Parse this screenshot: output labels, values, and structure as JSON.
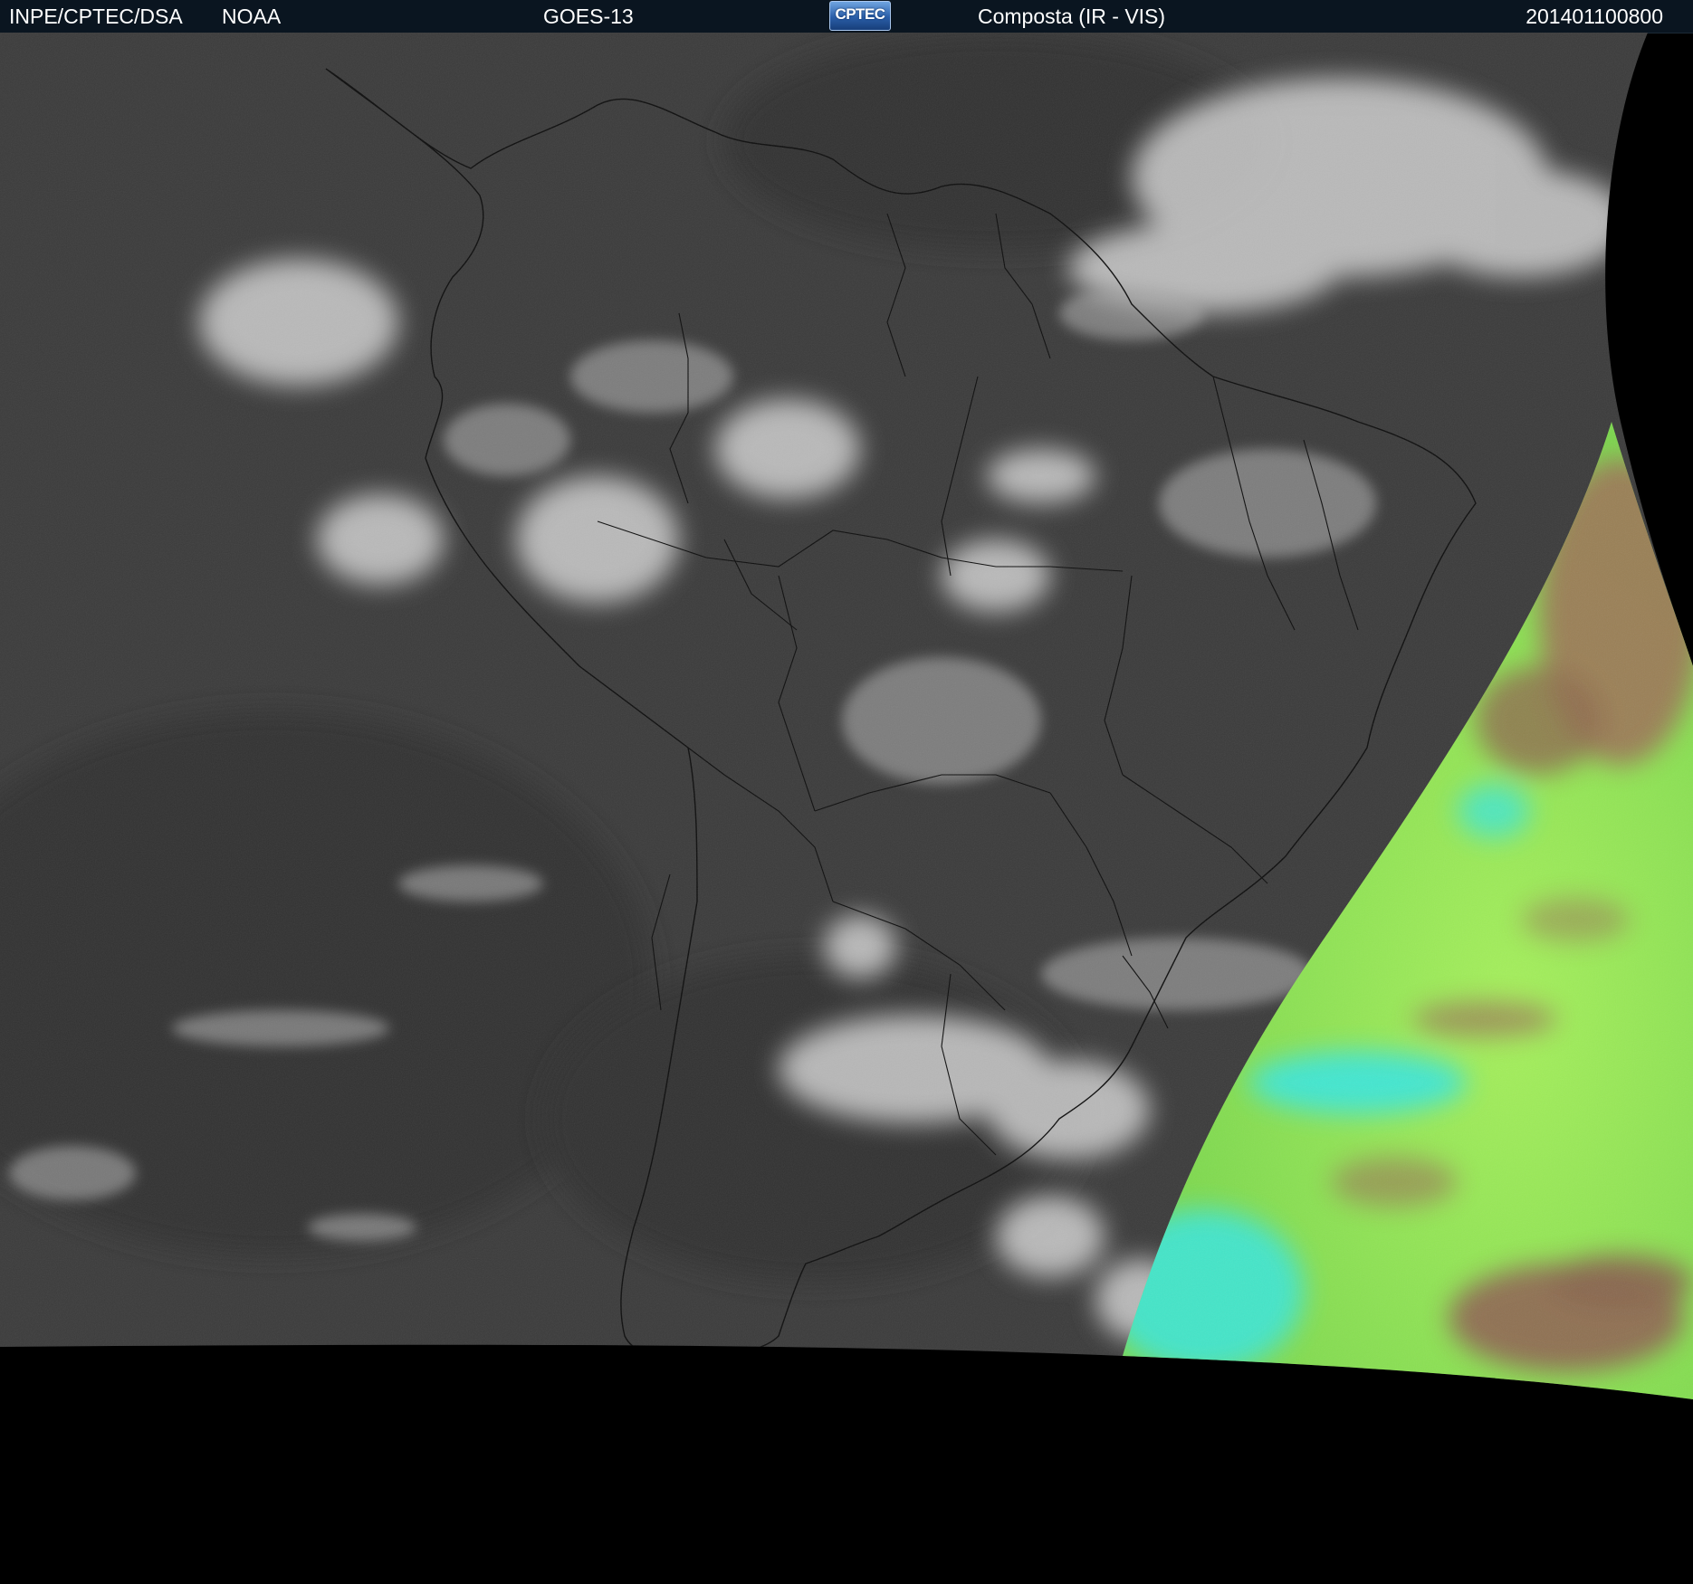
{
  "header": {
    "source": "INPE/CPTEC/DSA",
    "agency": "NOAA",
    "satellite": "GOES-13",
    "logo_text": "CPTEC",
    "product": "Composta (IR - VIS)",
    "timestamp": "201401100800"
  },
  "colors": {
    "header_bg": "#0a1520",
    "background": "#000000",
    "ir_gray": "#3a3a3a",
    "vis_green": "#8ee65a",
    "vis_cyan": "#3ee6d6",
    "vis_brown": "#8c6a4e"
  },
  "icons": {
    "logo": "cptec-logo"
  }
}
